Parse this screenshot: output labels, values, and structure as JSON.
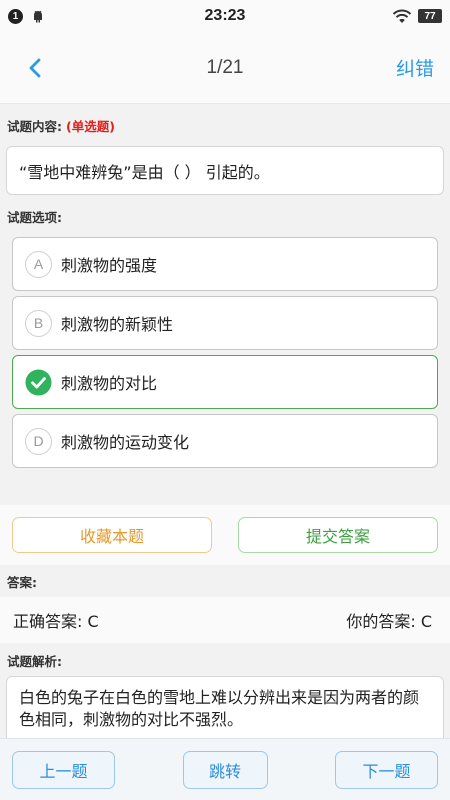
{
  "status": {
    "notification_count": "1",
    "time": "23:23",
    "battery": "77"
  },
  "header": {
    "counter": "1/21",
    "correct_label": "纠错"
  },
  "question": {
    "label": "试题内容:",
    "type": "(单选题)",
    "text": "“雪地中难辨兔”是由（ ） 引起的。"
  },
  "options": {
    "label": "试题选项:",
    "items": [
      {
        "letter": "A",
        "text": "刺激物的强度",
        "selected": false
      },
      {
        "letter": "B",
        "text": "刺激物的新颖性",
        "selected": false
      },
      {
        "letter": "C",
        "text": "刺激物的对比",
        "selected": true
      },
      {
        "letter": "D",
        "text": "刺激物的运动变化",
        "selected": false
      }
    ]
  },
  "actions": {
    "favorite_label": "收藏本题",
    "submit_label": "提交答案"
  },
  "answer": {
    "label": "答案:",
    "correct": "正确答案: C",
    "yours": "你的答案: C"
  },
  "analysis": {
    "label": "试题解析:",
    "text": "白色的兔子在白色的雪地上难以分辨出来是因为两者的颜色相同，刺激物的对比不强烈。"
  },
  "nav": {
    "prev_label": "上一题",
    "jump_label": "跳转",
    "next_label": "下一题"
  },
  "colors": {
    "accent": "#2b9be6",
    "selected": "#4caa4e",
    "favorite": "#e69a2c",
    "error_red": "#e0201c"
  }
}
